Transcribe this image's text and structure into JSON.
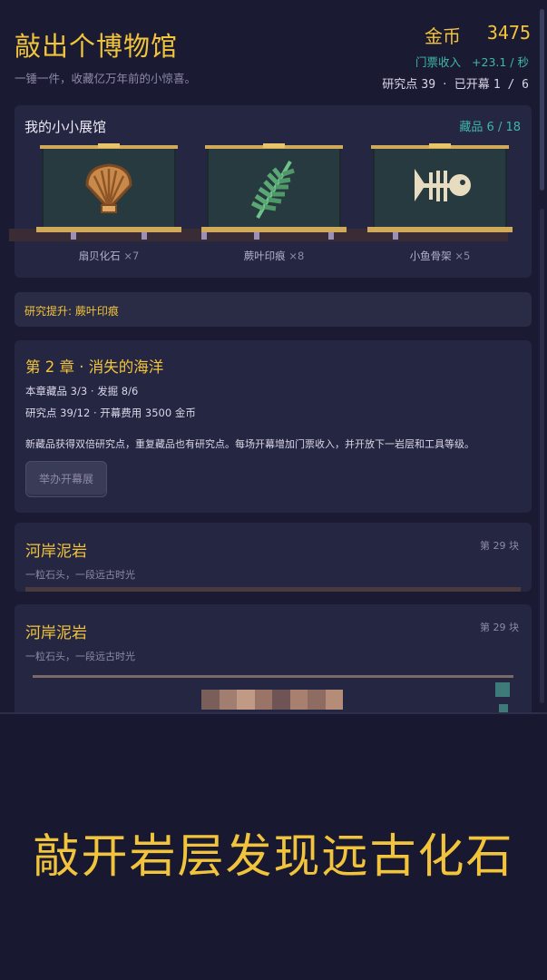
{
  "header": {
    "title": "敲出个博物馆",
    "subtitle": "一锤一件，收藏亿万年前的小惊喜。",
    "gold_label": "金币",
    "gold_value": "3475",
    "income_label": "门票收入",
    "income_value": "+23.1 / 秒",
    "research_label": "研究点",
    "research_value": "39",
    "separator": "·",
    "exhibit_label": "已开幕",
    "exhibit_value": "1 / 6"
  },
  "museum": {
    "title": "我的小小展馆",
    "count_label": "藏品 6 / 18",
    "cases": [
      {
        "name": "扇贝化石",
        "count": "×7",
        "icon": "scallop-fossil-icon"
      },
      {
        "name": "蕨叶印痕",
        "count": "×8",
        "icon": "fern-imprint-icon"
      },
      {
        "name": "小鱼骨架",
        "count": "×5",
        "icon": "fish-skeleton-icon"
      }
    ]
  },
  "boost": {
    "text": "研究提升: 蕨叶印痕"
  },
  "chapter": {
    "title": "第 2 章 · 消失的海洋",
    "line1": "本章藏品 3/3 · 发掘 8/6",
    "line2": "研究点 39/12 · 开幕费用 3500 金币",
    "description": "新藏品获得双倍研究点，重复藏品也有研究点。每场开幕增加门票收入，并开放下一岩层和工具等级。",
    "button_label": "举办开幕展"
  },
  "strata": [
    {
      "name": "河岸泥岩",
      "block": "第 29 块",
      "subtitle": "一粒石头，一段远古时光"
    },
    {
      "name": "河岸泥岩",
      "block": "第 29 块",
      "subtitle": "一粒石头，一段远古时光"
    }
  ],
  "banner": {
    "text": "敲开岩层发现远古化石"
  },
  "colors": {
    "background": "#1a1b33",
    "panel": "#252642",
    "gold": "#f2c43b",
    "teal": "#3fb8a6",
    "text": "#d9d6e8",
    "muted": "#8d8aa8"
  }
}
